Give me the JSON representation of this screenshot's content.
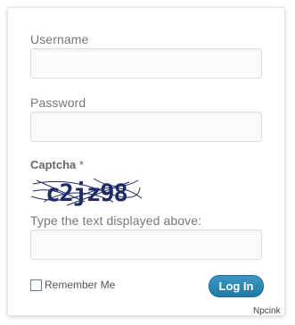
{
  "form": {
    "username_label": "Username",
    "username_value": "",
    "password_label": "Password",
    "password_value": "",
    "captcha_label": "Captcha",
    "captcha_required_mark": "*",
    "captcha_image_text": "c2jz98",
    "captcha_instruction": "Type the text displayed above:",
    "captcha_value": "",
    "remember_label": "Remember Me",
    "remember_checked": false,
    "login_button_label": "Log In"
  },
  "watermark": "Npcink",
  "colors": {
    "button": "#2a86b5",
    "captcha_text": "#1f2a66",
    "label": "#777777"
  }
}
